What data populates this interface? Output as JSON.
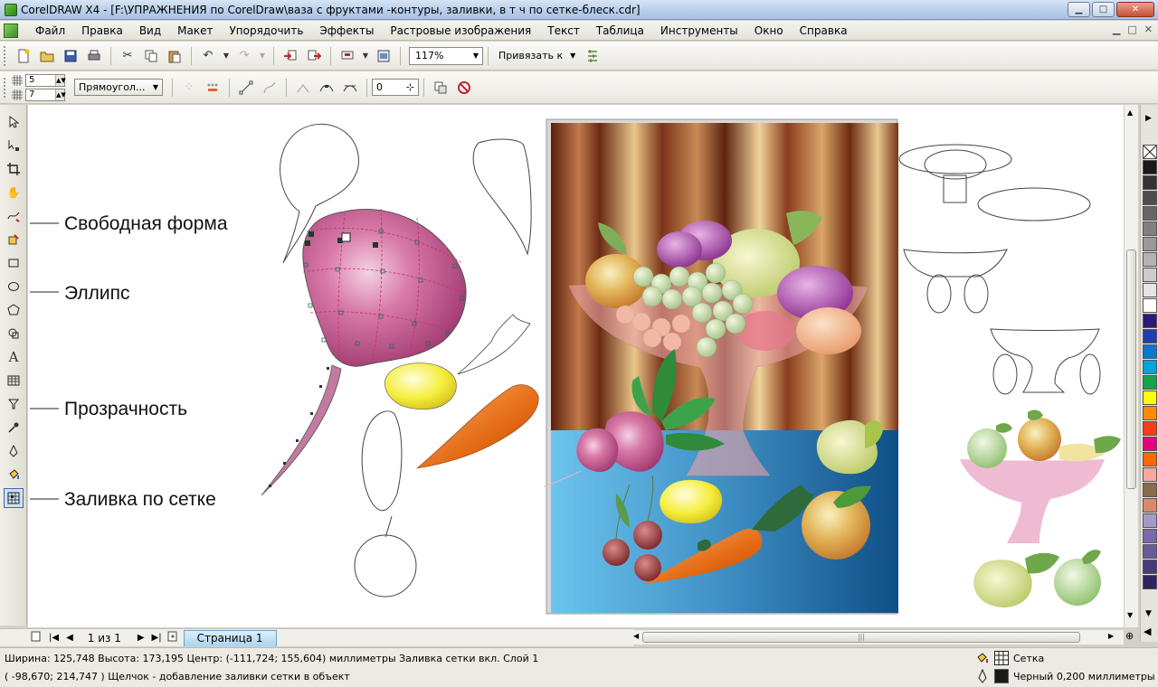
{
  "window": {
    "title": "CorelDRAW X4 - [F:\\УПРАЖНЕНИЯ по CorelDraw\\ваза с фруктами -контуры, заливки, в т ч по сетке-блеск.cdr]",
    "minimize": "▁",
    "maximize": "□",
    "close": "✕"
  },
  "menu": {
    "items": [
      "Файл",
      "Правка",
      "Вид",
      "Макет",
      "Упорядочить",
      "Эффекты",
      "Растровые изображения",
      "Текст",
      "Таблица",
      "Инструменты",
      "Окно",
      "Справка"
    ],
    "doc_controls": [
      "▁",
      "□",
      "✕"
    ]
  },
  "toolbar": {
    "zoom_value": "117%",
    "snap_label": "Привязать к"
  },
  "property_bar": {
    "rows_value": "5",
    "cols_value": "7",
    "selection_mode": "Прямоугол...",
    "smoothing_value": "0"
  },
  "callouts": {
    "freeform": "Свободная форма",
    "ellipse": "Эллипс",
    "transparency": "Прозрачность",
    "mesh_fill": "Заливка по сетке"
  },
  "page_nav": {
    "page_count": "1 из 1",
    "page_tab": "Страница 1"
  },
  "status": {
    "line1": "Ширина: 125,748  Высота: 173,195  Центр: (-111,724; 155,604)  миллиметры     Заливка сетки вкл. Слой 1",
    "line2": "( -98,670; 214,747 )     Щелчок - добавление заливки сетки в объект",
    "fill_label": "Сетка",
    "outline_label": "Черный  0,200 миллиметры",
    "outline_color": "#1a1a1a"
  },
  "palette_colors": [
    "#ffffff",
    "#1a1a1a",
    "#333333",
    "#4d4d4d",
    "#666666",
    "#808080",
    "#999999",
    "#b3b3b3",
    "#cccccc",
    "#e6e6e6",
    "#ffffff",
    "#2b1a7a",
    "#1f3fae",
    "#0a78d0",
    "#00a3e0",
    "#16a34a",
    "#ffff00",
    "#ff8c00",
    "#ff3b1a",
    "#e6007e",
    "#ff6a00",
    "#f7a8a0",
    "#8b6b4a",
    "#d98a6c",
    "#a89ac8",
    "#7b68ae",
    "#6a5a9a",
    "#4a3a7a",
    "#2e2460"
  ]
}
